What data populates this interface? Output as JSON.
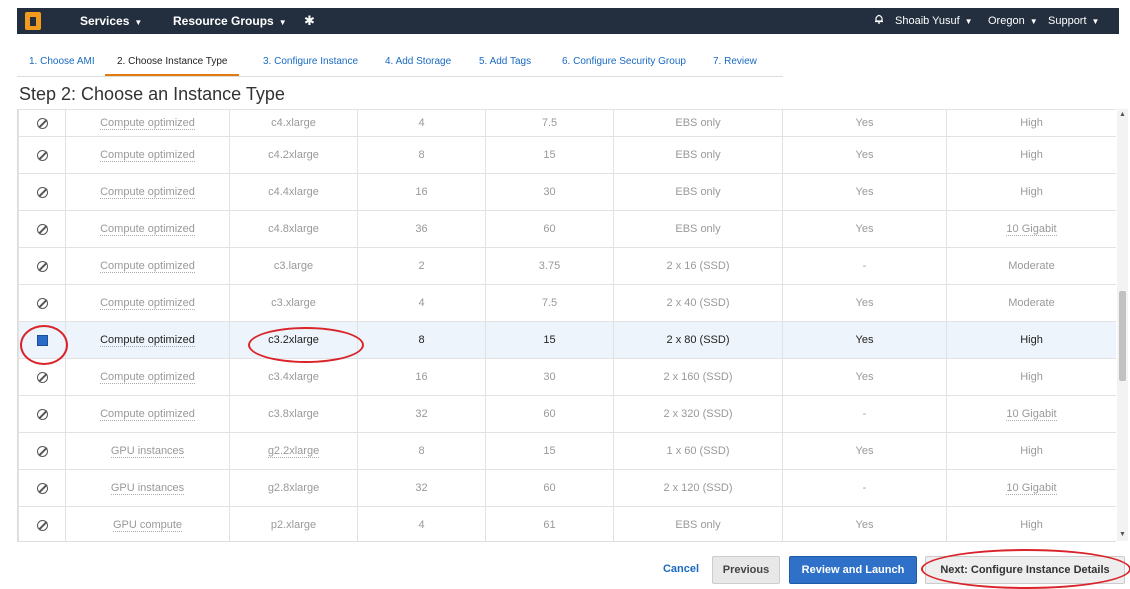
{
  "nav": {
    "services": "Services",
    "resource_groups": "Resource Groups",
    "user": "Shoaib Yusuf",
    "region": "Oregon",
    "support": "Support"
  },
  "steps": [
    "1. Choose AMI",
    "2. Choose Instance Type",
    "3. Configure Instance",
    "4. Add Storage",
    "5. Add Tags",
    "6. Configure Security Group",
    "7. Review"
  ],
  "page_title": "Step 2: Choose an Instance Type",
  "rows": [
    {
      "family": "Compute optimized",
      "type": "c4.xlarge",
      "vcpu": "4",
      "memory": "7.5",
      "storage": "EBS only",
      "ebs": "Yes",
      "network": "High"
    },
    {
      "family": "Compute optimized",
      "type": "c4.2xlarge",
      "vcpu": "8",
      "memory": "15",
      "storage": "EBS only",
      "ebs": "Yes",
      "network": "High"
    },
    {
      "family": "Compute optimized",
      "type": "c4.4xlarge",
      "vcpu": "16",
      "memory": "30",
      "storage": "EBS only",
      "ebs": "Yes",
      "network": "High"
    },
    {
      "family": "Compute optimized",
      "type": "c4.8xlarge",
      "vcpu": "36",
      "memory": "60",
      "storage": "EBS only",
      "ebs": "Yes",
      "network": "10 Gigabit"
    },
    {
      "family": "Compute optimized",
      "type": "c3.large",
      "vcpu": "2",
      "memory": "3.75",
      "storage": "2 x 16 (SSD)",
      "ebs": "-",
      "network": "Moderate"
    },
    {
      "family": "Compute optimized",
      "type": "c3.xlarge",
      "vcpu": "4",
      "memory": "7.5",
      "storage": "2 x 40 (SSD)",
      "ebs": "Yes",
      "network": "Moderate"
    },
    {
      "family": "Compute optimized",
      "type": "c3.2xlarge",
      "vcpu": "8",
      "memory": "15",
      "storage": "2 x 80 (SSD)",
      "ebs": "Yes",
      "network": "High"
    },
    {
      "family": "Compute optimized",
      "type": "c3.4xlarge",
      "vcpu": "16",
      "memory": "30",
      "storage": "2 x 160 (SSD)",
      "ebs": "Yes",
      "network": "High"
    },
    {
      "family": "Compute optimized",
      "type": "c3.8xlarge",
      "vcpu": "32",
      "memory": "60",
      "storage": "2 x 320 (SSD)",
      "ebs": "-",
      "network": "10 Gigabit"
    },
    {
      "family": "GPU instances",
      "type": "g2.2xlarge",
      "vcpu": "8",
      "memory": "15",
      "storage": "1 x 60 (SSD)",
      "ebs": "Yes",
      "network": "High"
    },
    {
      "family": "GPU instances",
      "type": "g2.8xlarge",
      "vcpu": "32",
      "memory": "60",
      "storage": "2 x 120 (SSD)",
      "ebs": "-",
      "network": "10 Gigabit"
    },
    {
      "family": "GPU compute",
      "type": "p2.xlarge",
      "vcpu": "4",
      "memory": "61",
      "storage": "EBS only",
      "ebs": "Yes",
      "network": "High"
    }
  ],
  "buttons": {
    "cancel": "Cancel",
    "previous": "Previous",
    "review": "Review and Launch",
    "next": "Next: Configure Instance Details"
  },
  "colors": {
    "accent": "#e07b0f",
    "primary": "#2f71c8",
    "annotation": "#d8242a",
    "nav_bg": "#232f3e"
  }
}
